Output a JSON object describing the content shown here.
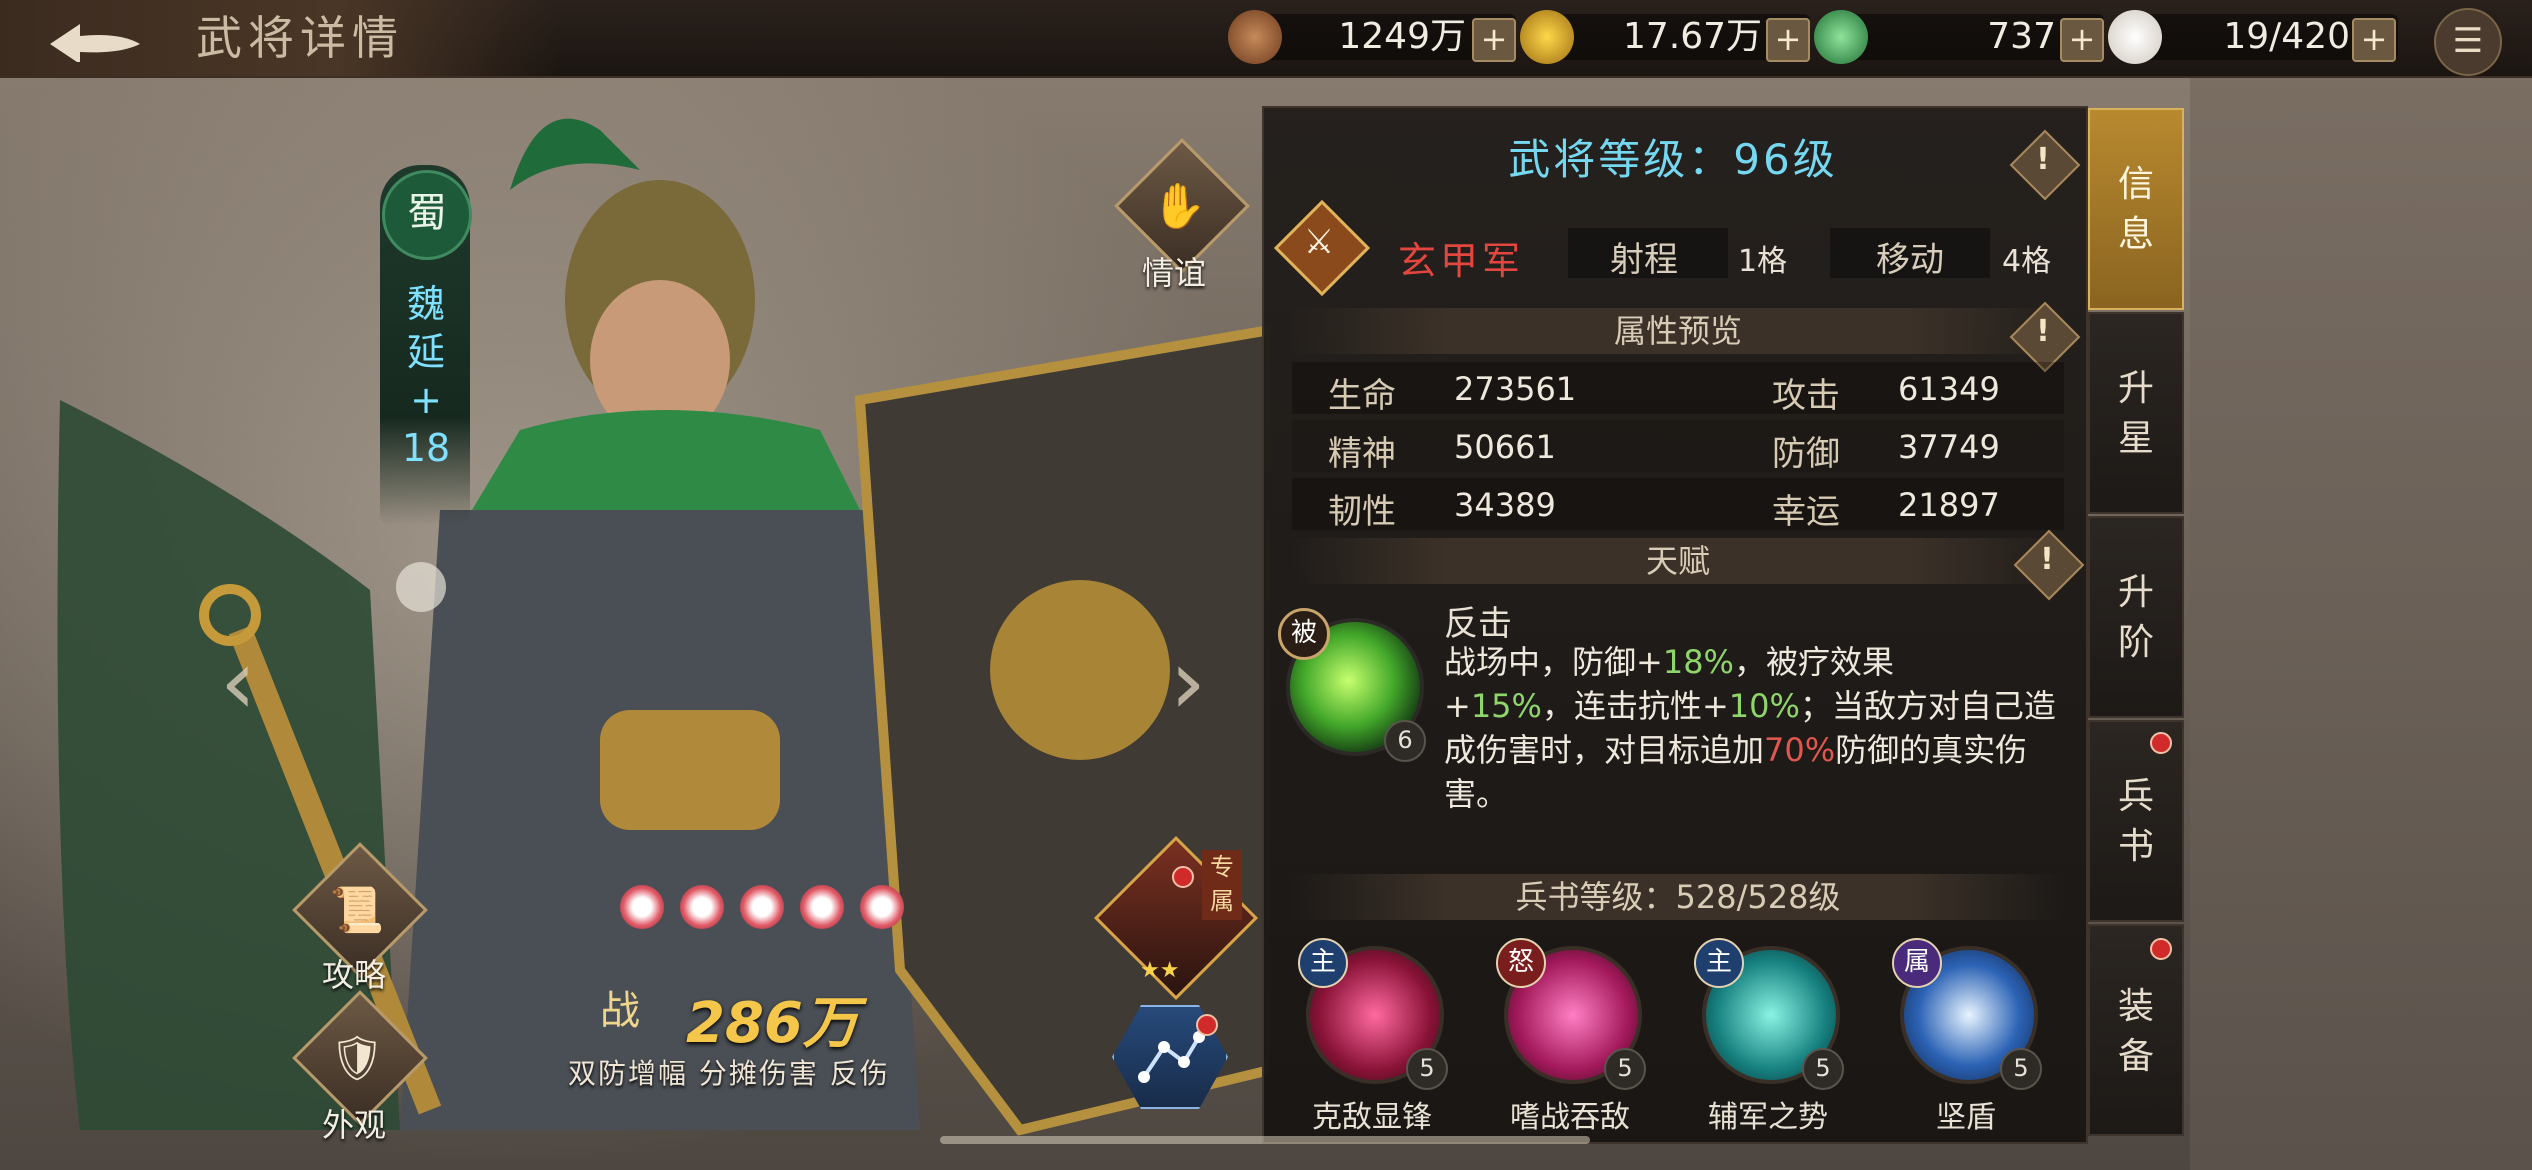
{
  "header": {
    "back_icon": "back-arrow-icon",
    "title": "武将详情"
  },
  "resources": [
    {
      "name": "copper-coins",
      "value": "1249万",
      "icon": "coin-stack-icon"
    },
    {
      "name": "gold-coins",
      "value": "17.67万",
      "icon": "gold-coin-icon"
    },
    {
      "name": "jade",
      "value": "737",
      "icon": "jade-disc-icon"
    },
    {
      "name": "food",
      "value": "19/420",
      "icon": "bun-icon"
    }
  ],
  "plus_label": "+",
  "menu_icon": "menu-list-icon",
  "general": {
    "faction": "蜀",
    "name_chars": [
      "魏",
      "延"
    ],
    "plus": "+",
    "level_plus": "18",
    "friendship_label": "情谊",
    "strategy_label": "攻略",
    "appearance_label": "外观",
    "power_badge": "战",
    "power_value": "286万",
    "power_tags": "双防增幅 分摊伤害 反伤",
    "exclusive_tag_chars": [
      "专",
      "属"
    ],
    "exclusive_stars": "★★",
    "star_count": 5
  },
  "panel": {
    "level_title": "武将等级：96级",
    "troop_type": "玄甲军",
    "range_label": "射程",
    "range_value": "1格",
    "move_label": "移动",
    "move_value": "4格",
    "attr_section": "属性预览",
    "attributes": [
      {
        "label": "生命",
        "value": "273561"
      },
      {
        "label": "攻击",
        "value": "61349"
      },
      {
        "label": "精神",
        "value": "50661"
      },
      {
        "label": "防御",
        "value": "37749"
      },
      {
        "label": "韧性",
        "value": "34389"
      },
      {
        "label": "幸运",
        "value": "21897"
      }
    ],
    "talent_section": "天赋",
    "talent": {
      "badge": "被",
      "level": "6",
      "name": "反击",
      "desc_1": "战场中，防御+",
      "val_1": "18%",
      "desc_2": "，被疗效果",
      "desc_3": "+",
      "val_2": "15%",
      "desc_4": "，连击抗性+",
      "val_3": "10%",
      "desc_5": "；当敌方对自己造成伤害时，对目标追加",
      "val_4": "70%",
      "desc_6": "防御的真实伤害。"
    },
    "book_section": "兵书等级：528/528级",
    "skills": [
      {
        "badge": "主",
        "name": "克敌显锋",
        "level": "5",
        "color": "#c7245c"
      },
      {
        "badge": "怒",
        "name": "嗜战吞敌",
        "level": "5",
        "color": "#d92e7a"
      },
      {
        "badge": "主",
        "name": "辅军之势",
        "level": "5",
        "color": "#1fa7a8"
      },
      {
        "badge": "属",
        "name": "坚盾",
        "level": "5",
        "color": "#2a6fc7"
      }
    ]
  },
  "tabs": [
    {
      "label_chars": [
        "信",
        "息"
      ],
      "active": true,
      "dot": false
    },
    {
      "label_chars": [
        "升",
        "星"
      ],
      "active": false,
      "dot": false
    },
    {
      "label_chars": [
        "升",
        "阶"
      ],
      "active": false,
      "dot": false
    },
    {
      "label_chars": [
        "兵",
        "书"
      ],
      "active": false,
      "dot": true
    },
    {
      "label_chars": [
        "装",
        "备"
      ],
      "active": false,
      "dot": true
    }
  ],
  "colors": {
    "accent_gold": "#b8892f",
    "level_cyan": "#75d8f0",
    "troop_red": "#e3463e",
    "buff_green": "#8fd56b"
  }
}
